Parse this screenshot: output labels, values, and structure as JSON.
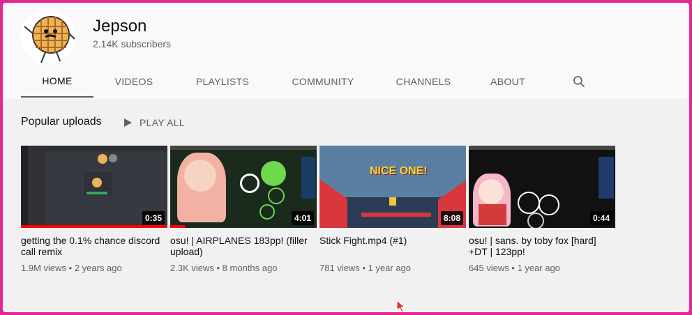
{
  "channel": {
    "name": "Jepson",
    "subscribers": "2.14K subscribers"
  },
  "tabs": [
    {
      "label": "HOME",
      "active": true
    },
    {
      "label": "VIDEOS"
    },
    {
      "label": "PLAYLISTS"
    },
    {
      "label": "COMMUNITY"
    },
    {
      "label": "CHANNELS"
    },
    {
      "label": "ABOUT"
    }
  ],
  "search_icon": "search-icon",
  "shelf": {
    "title": "Popular uploads",
    "play_all": "PLAY ALL"
  },
  "videos": [
    {
      "title": "getting the 0.1% chance discord call remix",
      "duration": "0:35",
      "views": "1.9M views",
      "age": "2 years ago",
      "watched": 1.0
    },
    {
      "title": "osu! | AIRPLANES 183pp! (filler upload)",
      "duration": "4:01",
      "views": "2.3K views",
      "age": "8 months ago",
      "watched": 0.1
    },
    {
      "title": "Stick Fight.mp4 (#1)",
      "duration": "8:08",
      "views": "781 views",
      "age": "1 year ago",
      "watched": 0,
      "thumb_text": "NICE ONE!"
    },
    {
      "title": "osu! | sans. by toby fox [hard] +DT | 123pp!",
      "duration": "0:44",
      "views": "645 views",
      "age": "1 year ago",
      "watched": 0
    }
  ],
  "colors": {
    "accent": "#ff0000",
    "frame": "#e8278a",
    "header_bg": "#f9f9f9",
    "body_bg": "#f1f1f1"
  }
}
